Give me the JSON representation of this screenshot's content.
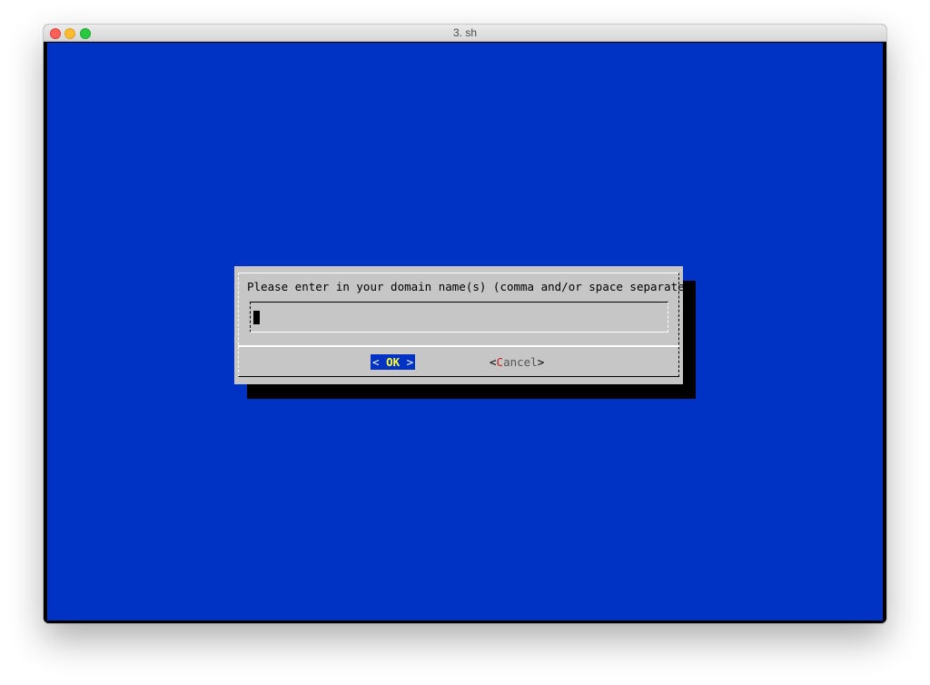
{
  "window": {
    "title": "3. sh"
  },
  "dialog": {
    "prompt": "Please enter in your domain name(s) (comma and/or space separated)",
    "input": {
      "value": ""
    },
    "buttons": {
      "ok": {
        "left": "< ",
        "label": "OK",
        "right": " >"
      },
      "cancel": {
        "left": "<",
        "hotkey": "C",
        "rest": "ancel",
        "right": ">"
      }
    }
  },
  "colors": {
    "terminal_background": "#0033c4",
    "dialog_background": "#c6c6c6",
    "button_highlight": "#0033c4",
    "button_label_active": "#ffff33",
    "hotkey": "#c81e1e"
  }
}
